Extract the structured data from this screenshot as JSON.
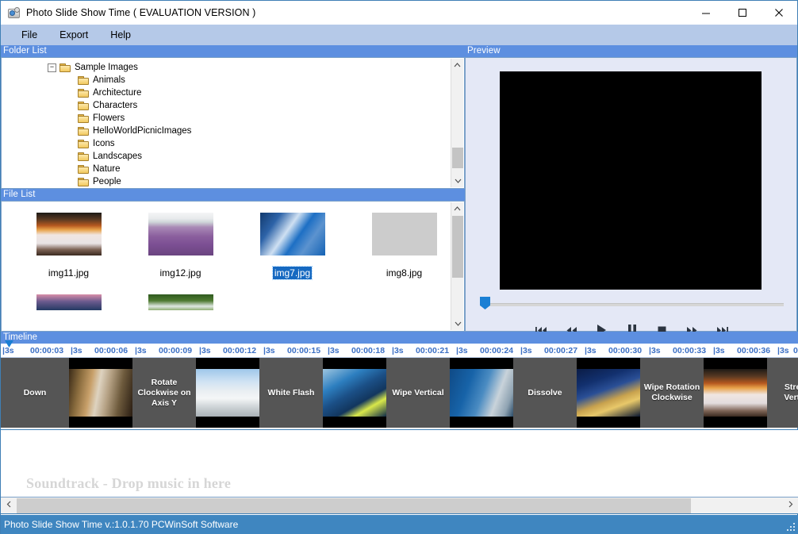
{
  "window": {
    "title": "Photo Slide Show Time ( EVALUATION VERSION )",
    "icon": "projector-icon",
    "minimize": "−",
    "maximize": "□",
    "close": "✕"
  },
  "menu": {
    "items": [
      {
        "label": "File"
      },
      {
        "label": "Export"
      },
      {
        "label": "Help"
      }
    ]
  },
  "folder_list": {
    "header": "Folder List",
    "root": {
      "label": "Sample Images",
      "expander": "−",
      "icon": "folder-icon"
    },
    "children": [
      {
        "label": "Animals",
        "icon": "folder-icon"
      },
      {
        "label": "Architecture",
        "icon": "folder-icon"
      },
      {
        "label": "Characters",
        "icon": "folder-icon"
      },
      {
        "label": "Flowers",
        "icon": "folder-icon"
      },
      {
        "label": "HelloWorldPicnicImages",
        "icon": "folder-icon"
      },
      {
        "label": "Icons",
        "icon": "folder-icon"
      },
      {
        "label": "Landscapes",
        "icon": "folder-icon"
      },
      {
        "label": "Nature",
        "icon": "folder-icon"
      },
      {
        "label": "People",
        "icon": "folder-icon"
      }
    ],
    "scroll_up_icon": "chevron-up-icon",
    "scroll_down_icon": "chevron-down-icon"
  },
  "file_list": {
    "header": "File List",
    "files": [
      {
        "name": "img11.jpg",
        "selected": false
      },
      {
        "name": "img12.jpg",
        "selected": false
      },
      {
        "name": "img7.jpg",
        "selected": true
      },
      {
        "name": "img8.jpg",
        "selected": false
      }
    ],
    "scroll_up_icon": "chevron-up-icon",
    "scroll_down_icon": "chevron-down-icon"
  },
  "preview": {
    "header": "Preview",
    "screen_color": "#000000",
    "transport": [
      {
        "name": "skip-to-start-button",
        "icon": "skip-back-icon"
      },
      {
        "name": "rewind-button",
        "icon": "rewind-icon"
      },
      {
        "name": "play-button",
        "icon": "play-icon"
      },
      {
        "name": "pause-button",
        "icon": "pause-icon"
      },
      {
        "name": "stop-button",
        "icon": "stop-icon"
      },
      {
        "name": "fast-forward-button",
        "icon": "fast-forward-icon"
      },
      {
        "name": "skip-to-end-button",
        "icon": "skip-forward-icon"
      }
    ]
  },
  "timeline": {
    "header": "Timeline",
    "ruler": [
      {
        "text": "|3s"
      },
      {
        "text": "00:00:03"
      },
      {
        "text": "|3s"
      },
      {
        "text": "00:00:06"
      },
      {
        "text": "|3s"
      },
      {
        "text": "00:00:09"
      },
      {
        "text": "|3s"
      },
      {
        "text": "00:00:12"
      },
      {
        "text": "|3s"
      },
      {
        "text": "00:00:15"
      },
      {
        "text": "|3s"
      },
      {
        "text": "00:00:18"
      },
      {
        "text": "|3s"
      },
      {
        "text": "00:00:21"
      },
      {
        "text": "|3s"
      },
      {
        "text": "00:00:24"
      },
      {
        "text": "|3s"
      },
      {
        "text": "00:00:27"
      },
      {
        "text": "|3s"
      },
      {
        "text": "00:00:30"
      },
      {
        "text": "|3s"
      },
      {
        "text": "00:00:33"
      },
      {
        "text": "|3s"
      },
      {
        "text": "00:00:36"
      },
      {
        "text": "|3s"
      },
      {
        "text": "0"
      }
    ],
    "clips": [
      {
        "type": "transition",
        "label": "Down"
      },
      {
        "type": "image",
        "label": ""
      },
      {
        "type": "transition",
        "label": "Rotate Clockwise on Axis Y"
      },
      {
        "type": "image",
        "label": ""
      },
      {
        "type": "transition",
        "label": "White Flash"
      },
      {
        "type": "image",
        "label": ""
      },
      {
        "type": "transition",
        "label": "Wipe Vertical"
      },
      {
        "type": "image",
        "label": ""
      },
      {
        "type": "transition",
        "label": "Dissolve"
      },
      {
        "type": "image",
        "label": ""
      },
      {
        "type": "transition",
        "label": "Wipe Rotation Clockwise"
      },
      {
        "type": "image",
        "label": ""
      },
      {
        "type": "transition",
        "label": "Stretch Vertical"
      }
    ]
  },
  "soundtrack": {
    "placeholder": "Soundtrack - Drop music in here",
    "scroll_left_icon": "chevron-left-icon",
    "scroll_right_icon": "chevron-right-icon"
  },
  "status_bar": {
    "text": "Photo Slide Show Time v.:1.0.1.70 PCWinSoft Software"
  },
  "colors": {
    "panel_header": "#5d8fe0",
    "menu_bar": "#b5c9e8",
    "status_bar": "#3f86c0",
    "selection": "#1669c1",
    "timeline_bg": "#4a4a4a",
    "transition_bg": "#555555"
  }
}
